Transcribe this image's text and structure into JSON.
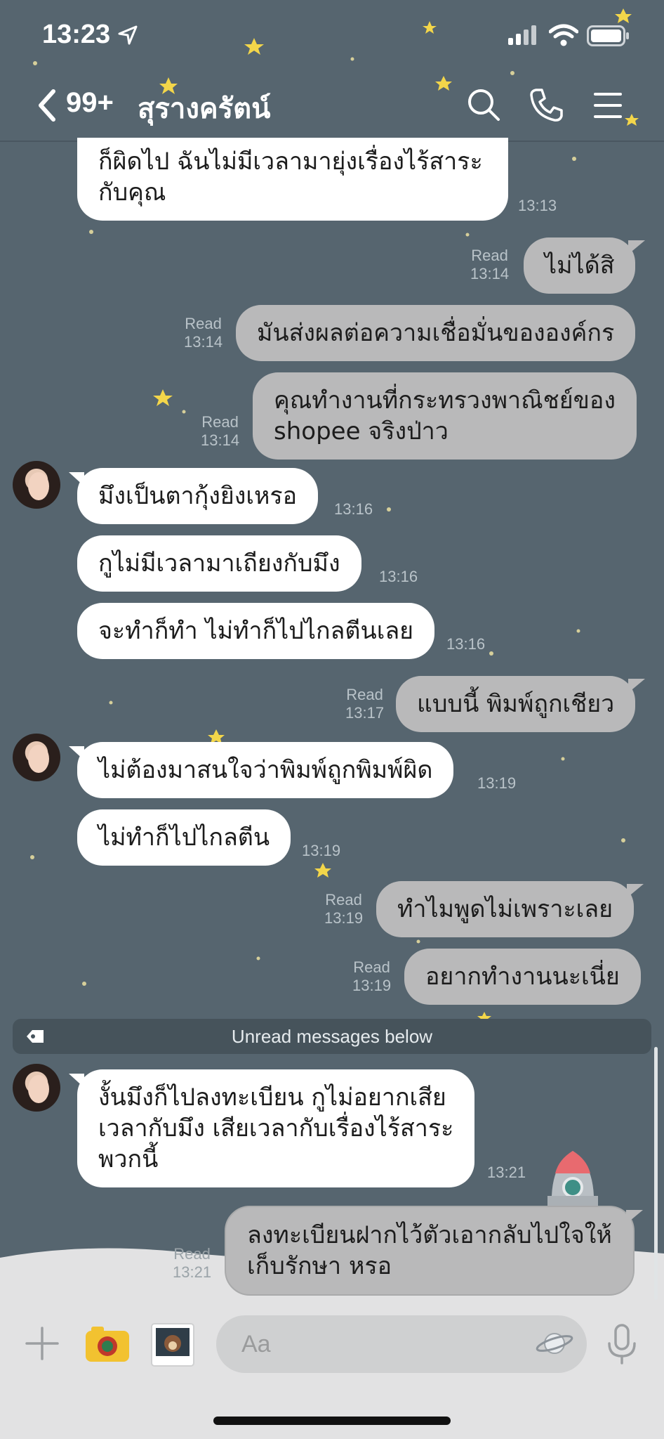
{
  "status": {
    "time": "13:23"
  },
  "header": {
    "unread": "99+",
    "title": "สุรางครัตน์"
  },
  "messages": [
    {
      "dir": "in",
      "lines": [
        "ก็ผิดไป ฉันไม่มีเวลามายุ่งเรื่องไร้สาระ",
        "กับคุณ"
      ],
      "time": "13:13"
    },
    {
      "dir": "out",
      "lines": [
        "ไม่ได้สิ"
      ],
      "read": "Read",
      "time": "13:14"
    },
    {
      "dir": "out",
      "lines": [
        "มันส่งผลต่อความเชื่อมั่นขององค์กร"
      ],
      "read": "Read",
      "time": "13:14"
    },
    {
      "dir": "out",
      "lines": [
        "คุณทำงานที่กระทรวงพาณิชย์ของ",
        "shopee จริงป่าว"
      ],
      "read": "Read",
      "time": "13:14"
    },
    {
      "dir": "in",
      "lines": [
        "มึงเป็นตากุ้งยิงเหรอ"
      ],
      "time": "13:16"
    },
    {
      "dir": "in",
      "lines": [
        "กูไม่มีเวลามาเถียงกับมึง"
      ],
      "time": "13:16"
    },
    {
      "dir": "in",
      "lines": [
        "จะทำก็ทำ ไม่ทำก็ไปไกลตีนเลย"
      ],
      "time": "13:16"
    },
    {
      "dir": "out",
      "lines": [
        "แบบนี้ พิมพ์ถูกเชียว"
      ],
      "read": "Read",
      "time": "13:17"
    },
    {
      "dir": "in",
      "lines": [
        "ไม่ต้องมาสนใจว่าพิมพ์ถูกพิมพ์ผิด"
      ],
      "time": "13:19"
    },
    {
      "dir": "in",
      "lines": [
        "ไม่ทำก็ไปไกลตีน"
      ],
      "time": "13:19"
    },
    {
      "dir": "out",
      "lines": [
        "ทำไมพูดไม่เพราะเลย"
      ],
      "read": "Read",
      "time": "13:19"
    },
    {
      "dir": "out",
      "lines": [
        "อยากทำงานนะเนี่ย"
      ],
      "read": "Read",
      "time": "13:19"
    },
    {
      "dir": "in",
      "lines": [
        "งั้นมึงก็ไปลงทะเบียน กูไม่อยากเสีย",
        "เวลากับมึง เสียเวลากับเรื่องไร้สาระ",
        "พวกนี้"
      ],
      "time": "13:21"
    },
    {
      "dir": "out",
      "lines": [
        "ลงทะเบียนฝากไว้ตัวเอากลับไปใจให้",
        "เก็บรักษา หรอ"
      ],
      "read": "Read",
      "time": "13:21"
    }
  ],
  "unread_divider": "Unread messages below",
  "input": {
    "placeholder": "Aa"
  },
  "icons": [
    "location-arrow-icon",
    "signal-icon",
    "wifi-icon",
    "battery-icon",
    "back-chevron-icon",
    "search-icon",
    "phone-icon",
    "menu-icon",
    "tag-icon",
    "plus-icon",
    "camera-icon",
    "sticker-icon",
    "planet-icon",
    "mic-icon"
  ],
  "colors": {
    "background": "#56656f",
    "incoming": "#ffffff",
    "outgoing": "#b9b9ba",
    "bottom_bar": "#e2e2e3"
  }
}
